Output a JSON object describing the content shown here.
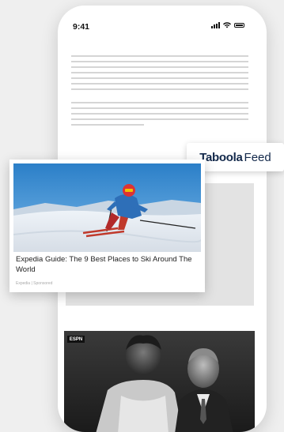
{
  "status_bar": {
    "time": "9:41",
    "icons": [
      "signal-icon",
      "wifi-icon",
      "battery-icon"
    ]
  },
  "taboola": {
    "brand": "Taboola",
    "feed": "Feed",
    "brand_color": "#13294b"
  },
  "ad": {
    "title": "Expedia Guide: The 9 Best Places to Ski Around The World",
    "source": "Expedia",
    "separator": "|",
    "label": "Sponsored"
  },
  "espn": {
    "logo": "ESPN"
  }
}
